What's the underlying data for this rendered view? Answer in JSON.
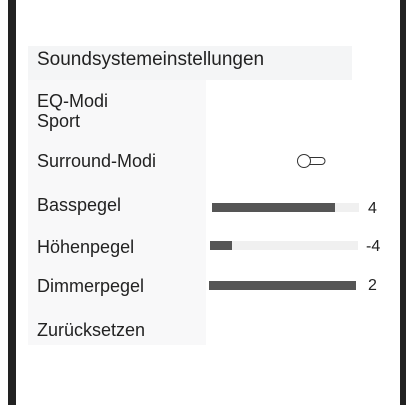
{
  "panel": {
    "title": "Soundsystemeinstellungen"
  },
  "eq": {
    "label": "EQ-Modi",
    "value": "Sport"
  },
  "surround": {
    "label": "Surround-Modi",
    "toggle_state": "off"
  },
  "bass": {
    "label": "Basspegel",
    "value": "4",
    "level_fraction": 0.84
  },
  "treble": {
    "label": "Höhenpegel",
    "value": "-4",
    "level_fraction": 0.15
  },
  "dimmer": {
    "label": "Dimmerpegel",
    "value": "2",
    "level_fraction": 1.0
  },
  "reset": {
    "label": "Zurücksetzen"
  },
  "colors": {
    "slider_fill": "#555555",
    "slider_track": "#f0f0f0",
    "frame": "#222222"
  }
}
